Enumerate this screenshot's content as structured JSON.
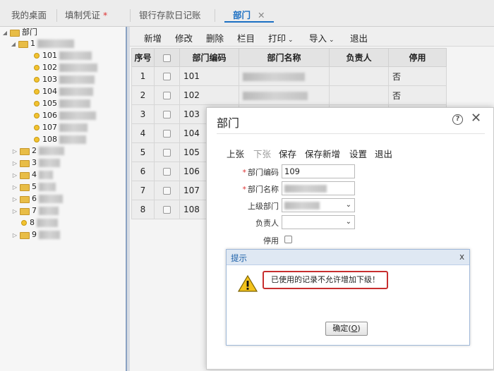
{
  "tabs": [
    {
      "label": "我的桌面"
    },
    {
      "label": "填制凭证",
      "modified_mark": "*"
    },
    {
      "label": "银行存款日记账"
    },
    {
      "label": "部门",
      "close": "✕"
    }
  ],
  "tree": {
    "root_label": "部门",
    "expanded_node_label": "1",
    "children": [
      "101",
      "102",
      "103",
      "104",
      "105",
      "106",
      "107",
      "108"
    ],
    "siblings": [
      "2",
      "3",
      "4",
      "5",
      "6",
      "7",
      "8",
      "9"
    ]
  },
  "toolbar": {
    "new": "新增",
    "edit": "修改",
    "delete": "删除",
    "columns": "栏目",
    "print": "打印",
    "import": "导入",
    "exit": "退出"
  },
  "grid": {
    "headers": [
      "序号",
      "",
      "部门编码",
      "部门名称",
      "负责人",
      "停用"
    ],
    "rows": [
      {
        "index": "1",
        "code": "101",
        "disabled": "否"
      },
      {
        "index": "2",
        "code": "102",
        "disabled": "否"
      },
      {
        "index": "3",
        "code": "103",
        "disabled": ""
      },
      {
        "index": "4",
        "code": "104",
        "disabled": ""
      },
      {
        "index": "5",
        "code": "105",
        "disabled": ""
      },
      {
        "index": "6",
        "code": "106",
        "disabled": ""
      },
      {
        "index": "7",
        "code": "107",
        "disabled": ""
      },
      {
        "index": "8",
        "code": "108",
        "disabled": ""
      }
    ]
  },
  "dialog": {
    "title": "部门",
    "help": "?",
    "close": "✕",
    "buttons": {
      "prev": "上张",
      "next": "下张",
      "save": "保存",
      "save_new": "保存新增",
      "settings": "设置",
      "exit": "退出"
    },
    "fields": {
      "code_label": "部门编码",
      "code_value": "109",
      "name_label": "部门名称",
      "parent_label": "上级部门",
      "manager_label": "负责人",
      "disabled_label": "停用",
      "required_mark": "*"
    }
  },
  "alert": {
    "title": "提示",
    "close": "x",
    "message": "已使用的记录不允许增加下级！",
    "ok_label": "确定(",
    "ok_key": "O",
    "ok_suffix": ")"
  },
  "colors": {
    "accent": "#1b6fc3",
    "required": "#d33333",
    "highlight_border": "#c72e2e",
    "folder": "#e8bd47"
  }
}
